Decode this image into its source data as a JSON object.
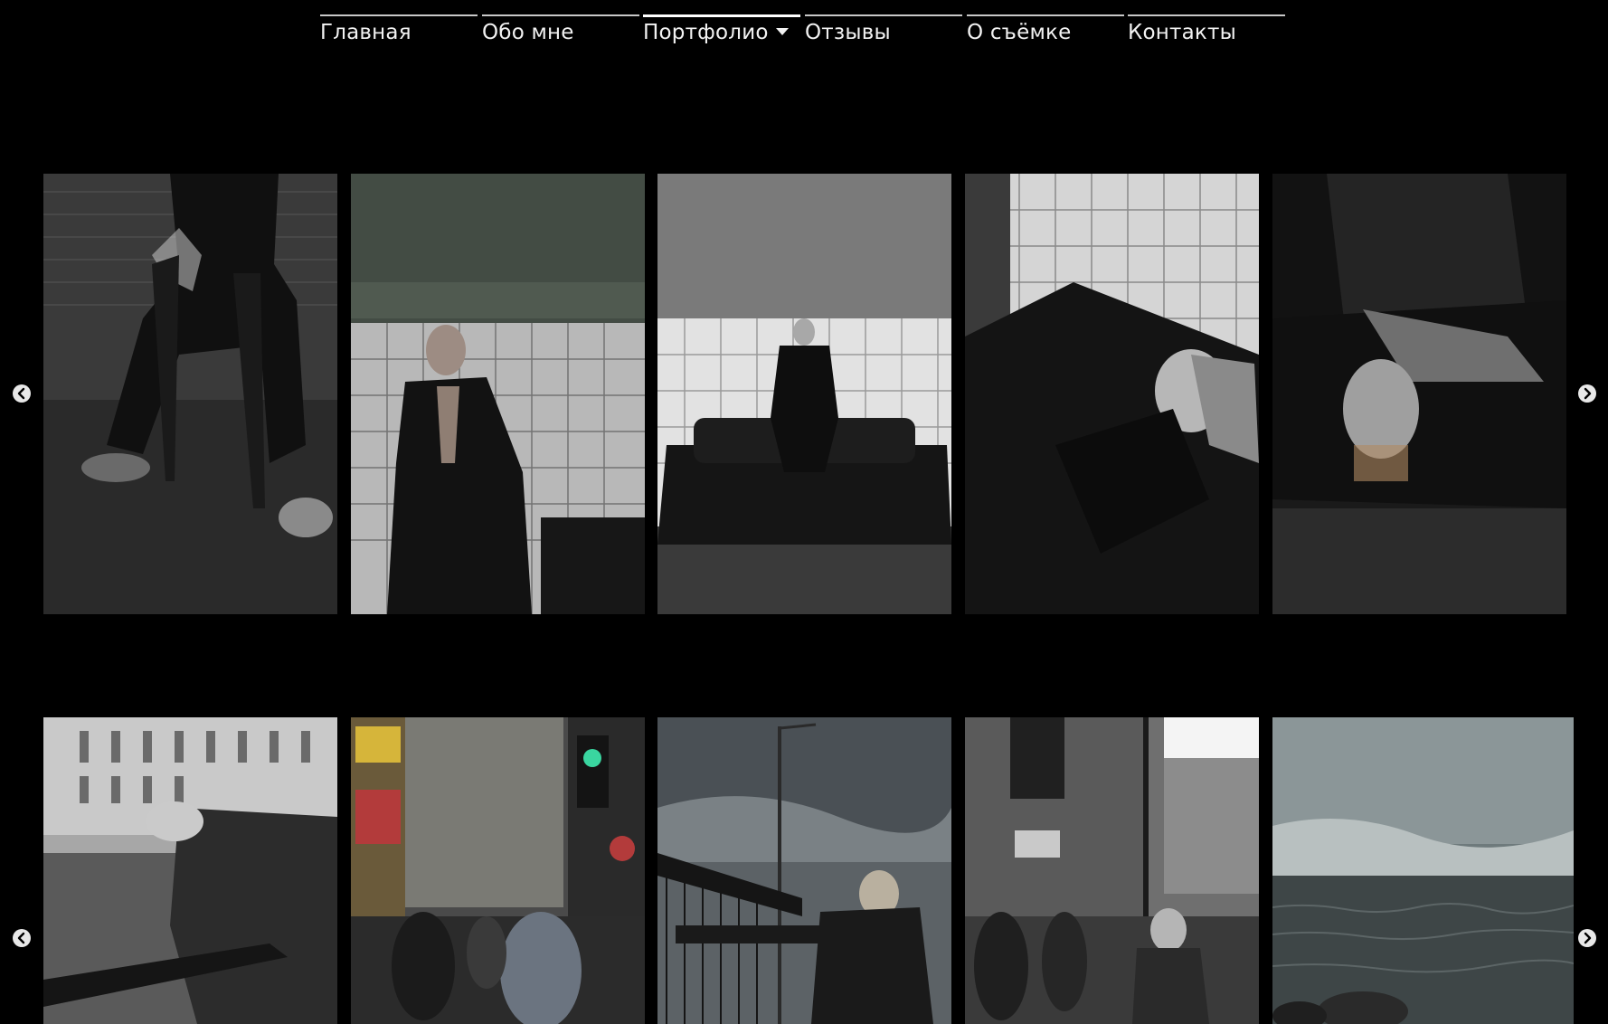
{
  "nav": {
    "items": [
      {
        "label": "Главная",
        "active": false
      },
      {
        "label": "Обо мне",
        "active": false
      },
      {
        "label": "Портфолио",
        "active": true,
        "icon": "caret-down-icon"
      },
      {
        "label": "Отзывы",
        "active": false
      },
      {
        "label": "О съёмке",
        "active": false
      },
      {
        "label": "Контакты",
        "active": false
      }
    ]
  },
  "gallery_rows": [
    {
      "prev_icon": "chevron-left-icon",
      "next_icon": "chevron-right-icon",
      "photos": [
        {
          "name": "photo-woman-on-chair"
        },
        {
          "name": "photo-woman-against-tiles"
        },
        {
          "name": "photo-woman-on-sofa"
        },
        {
          "name": "photo-woman-lying-on-sofa"
        },
        {
          "name": "photo-woman-lying-close-up"
        }
      ]
    },
    {
      "prev_icon": "chevron-left-icon",
      "next_icon": "chevron-right-icon",
      "photos": [
        {
          "name": "photo-woman-leaning-on-railing"
        },
        {
          "name": "photo-street-crowd-traffic-light"
        },
        {
          "name": "photo-woman-on-bridge"
        },
        {
          "name": "photo-woman-on-street-corner"
        },
        {
          "name": "photo-sea-and-sky"
        }
      ]
    }
  ],
  "colors": {
    "background": "#000000",
    "nav_text": "#f2f2f2",
    "nav_border": "#c8c8c8"
  }
}
